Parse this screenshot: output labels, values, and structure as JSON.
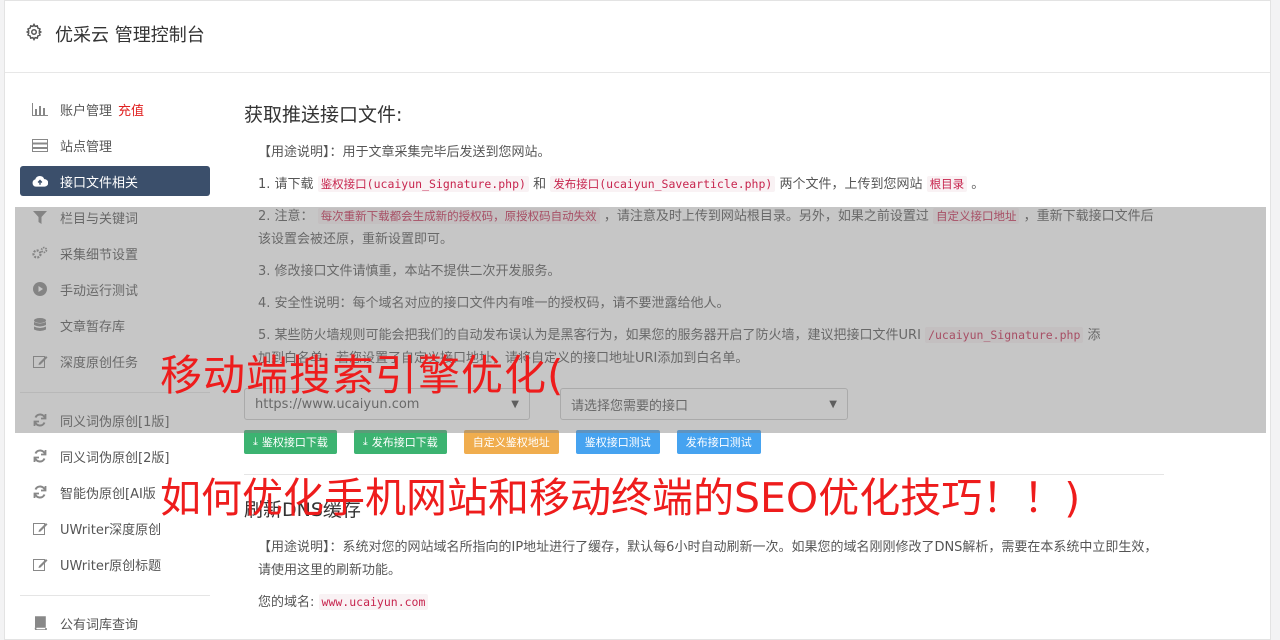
{
  "header": {
    "title": "优采云 管理控制台",
    "icon": "gear-icon"
  },
  "sidebar": {
    "items": [
      {
        "label": "账户管理",
        "badge": "充值",
        "icon": "bar-chart-icon"
      },
      {
        "label": "站点管理",
        "icon": "server-icon"
      },
      {
        "label": "接口文件相关",
        "icon": "cloud-upload-icon",
        "active": true
      },
      {
        "label": "栏目与关键词",
        "icon": "filter-icon"
      },
      {
        "label": "采集细节设置",
        "icon": "cogs-icon"
      },
      {
        "label": "手动运行测试",
        "icon": "play-circle-icon"
      },
      {
        "label": "文章暂存库",
        "icon": "database-icon"
      },
      {
        "label": "深度原创任务",
        "icon": "edit-icon"
      },
      {
        "label": "同义词伪原创[1版]",
        "icon": "refresh-icon"
      },
      {
        "label": "同义词伪原创[2版]",
        "icon": "refresh-icon"
      },
      {
        "label": "智能伪原创[AI版",
        "icon": "refresh-icon"
      },
      {
        "label": "UWriter深度原创",
        "icon": "edit-icon"
      },
      {
        "label": "UWriter原创标题",
        "icon": "edit-icon"
      },
      {
        "label": "公有词库查询",
        "icon": "book-icon"
      }
    ]
  },
  "section1": {
    "title": "获取推送接口文件:",
    "usage": "【用途说明】：用于文章采集完毕后发送到您网站。",
    "step1_a": "1. 请下载",
    "step1_code1": "鉴权接口(ucaiyun_Signature.php)",
    "step1_and": "和",
    "step1_code2": "发布接口(ucaiyun_Savearticle.php)",
    "step1_b": "两个文件，上传到您网站",
    "step1_code3": "根目录",
    "step1_end": "。",
    "step2_a": "2. 注意：",
    "step2_code1": "每次重新下载都会生成新的授权码，原授权码自动失效",
    "step2_b": "，请注意及时上传到网站根目录。另外，如果之前设置过",
    "step2_code2": "自定义接口地址",
    "step2_c": "，重新下载接口文件后该设置会被还原，重新设置即可。",
    "step3": "3. 修改接口文件请慎重，本站不提供二次开发服务。",
    "step4": "4. 安全性说明：每个域名对应的接口文件内有唯一的授权码，请不要泄露给他人。",
    "step5_a": "5. 某些防火墙规则可能会把我们的自动发布误认为是黑客行为，如果您的服务器开启了防火墙，建议把接口文件URI",
    "step5_code": "/ucaiyun_Signature.php",
    "step5_b": "添",
    "step5_c": "加到白名单；若您设置了自定义接口地址，请将自定义的接口地址URI添加到白名单。",
    "site_select": "https://www.ucaiyun.com",
    "iface_select": "请选择您需要的接口",
    "buttons": {
      "download_sign": "鉴权接口下载",
      "download_publish": "发布接口下载",
      "custom_sign": "自定义鉴权地址",
      "test_sign": "鉴权接口测试",
      "test_publish": "发布接口测试"
    }
  },
  "section2": {
    "title": "刷新DNS缓存",
    "usage": "【用途说明】：系统对您的网站域名所指向的IP地址进行了缓存，默认每6小时自动刷新一次。如果您的域名刚刚修改了DNS解析，需要在本系统中立即生效，请使用这里的刷新功能。",
    "domain_label": "您的域名:",
    "domain_value": "www.ucaiyun.com"
  },
  "watermark": {
    "line1": "移动端搜索引擎优化(",
    "line2": "如何优化手机网站和移动终端的SEO优化技巧！！)"
  }
}
